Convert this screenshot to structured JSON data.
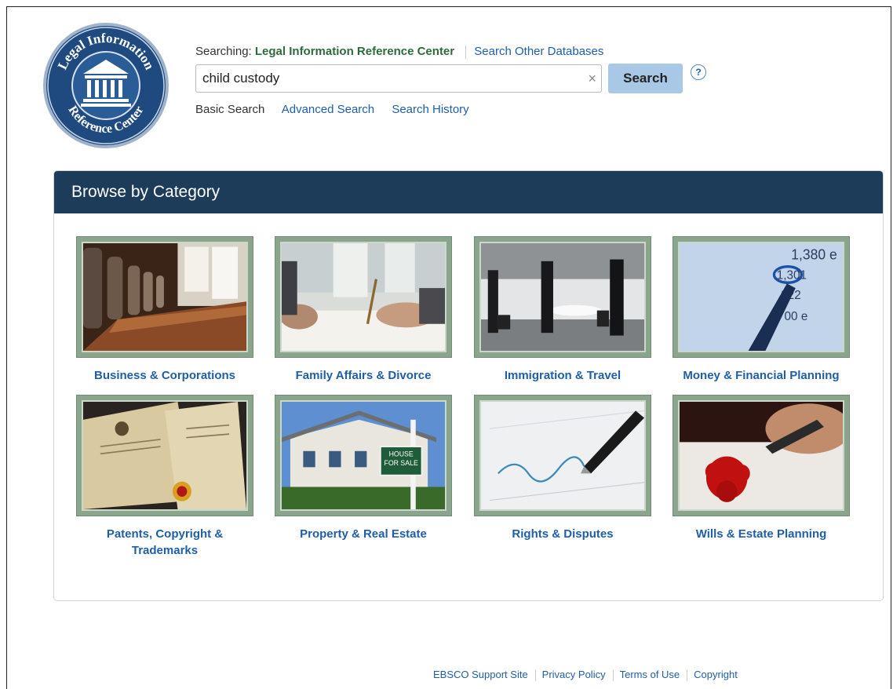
{
  "logo": {
    "text_top": "Legal Information",
    "text_bottom": "Reference Center"
  },
  "search": {
    "searching_label": "Searching:",
    "database": "Legal Information Reference Center",
    "other_databases": "Search Other Databases",
    "query": "child custody",
    "clear_icon": "×",
    "button_label": "Search",
    "help_icon": "?",
    "links": {
      "basic": "Basic Search",
      "advanced": "Advanced Search",
      "history": "Search History"
    }
  },
  "browse": {
    "title": "Browse by Category",
    "categories": [
      {
        "label": "Business & Corporations",
        "icon": "boardroom-image"
      },
      {
        "label": "Family Affairs & Divorce",
        "icon": "signing-documents-image"
      },
      {
        "label": "Immigration & Travel",
        "icon": "airport-travelers-image"
      },
      {
        "label": "Money & Financial Planning",
        "icon": "financial-figures-image"
      },
      {
        "label": "Patents, Copyright & Trademarks",
        "icon": "patent-certificate-image"
      },
      {
        "label": "Property & Real Estate",
        "icon": "house-for-sale-image"
      },
      {
        "label": "Rights & Disputes",
        "icon": "pen-signature-image"
      },
      {
        "label": "Wills & Estate Planning",
        "icon": "wax-seal-image"
      }
    ],
    "house_sign": "HOUSE FOR SALE",
    "money_numbers": [
      "1,380 e",
      "1,301",
      "322",
      "00 e"
    ]
  },
  "footer": {
    "links": [
      "EBSCO Support Site",
      "Privacy Policy",
      "Terms of Use",
      "Copyright"
    ]
  },
  "colors": {
    "header_bg": "#1d3c5a",
    "link": "#1f5ea8",
    "tile_frame": "#8aa58c",
    "search_button": "#a9c8e6",
    "database_green": "#2e6b3a"
  }
}
